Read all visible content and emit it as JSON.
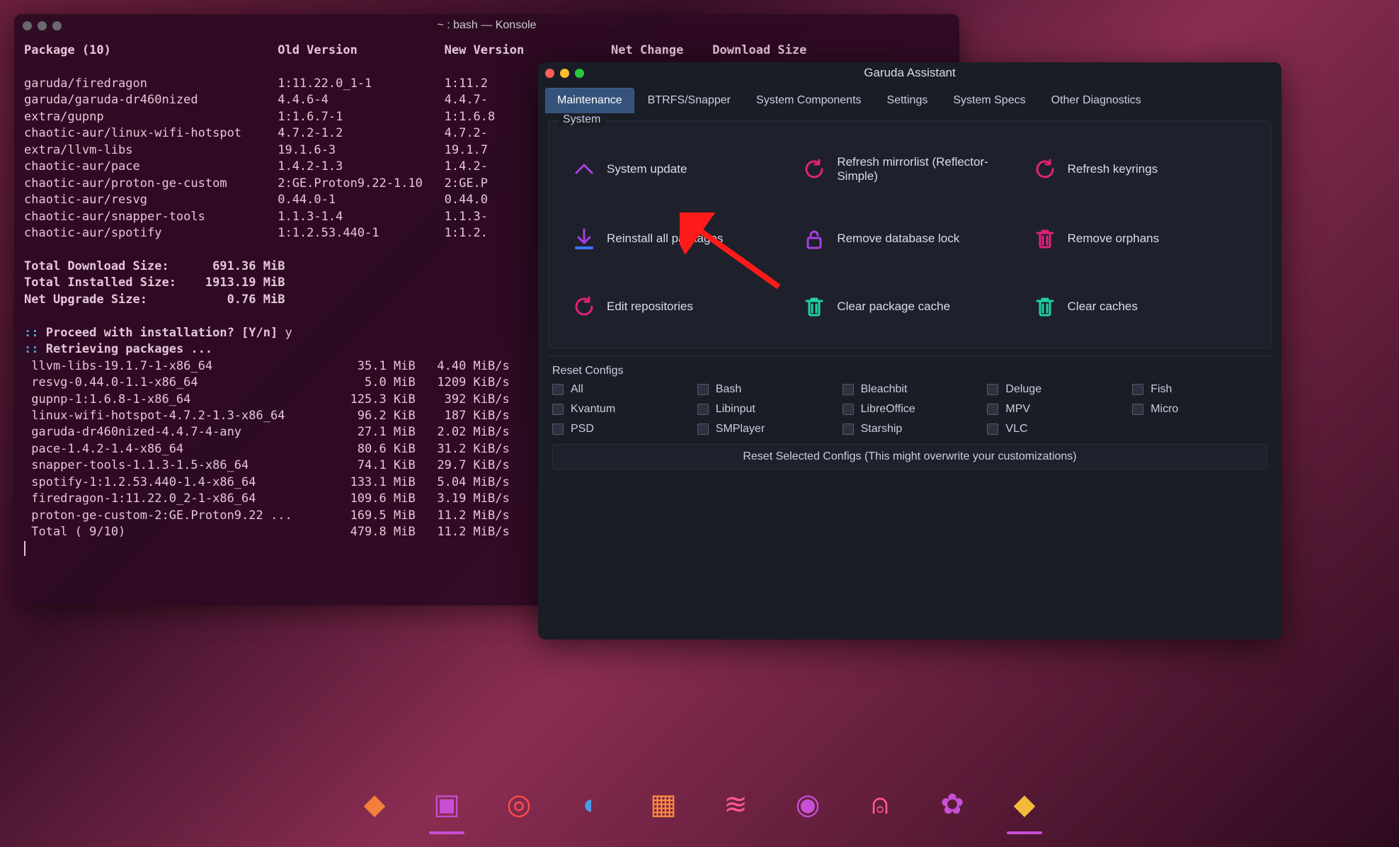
{
  "konsole": {
    "title": "~ : bash — Konsole",
    "header": {
      "col1": "Package (10)",
      "col2": "Old Version",
      "col3": "New Version",
      "col4": "Net Change",
      "col5": "Download Size"
    },
    "packages": [
      {
        "name": "garuda/firedragon",
        "old": "1:11.22.0_1-1",
        "new_prefix": "1:11.2"
      },
      {
        "name": "garuda/garuda-dr460nized",
        "old": "4.4.6-4",
        "new_prefix": "4.4.7-"
      },
      {
        "name": "extra/gupnp",
        "old": "1:1.6.7-1",
        "new_prefix": "1:1.6.8"
      },
      {
        "name": "chaotic-aur/linux-wifi-hotspot",
        "old": "4.7.2-1.2",
        "new_prefix": "4.7.2-"
      },
      {
        "name": "extra/llvm-libs",
        "old": "19.1.6-3",
        "new_prefix": "19.1.7"
      },
      {
        "name": "chaotic-aur/pace",
        "old": "1.4.2-1.3",
        "new_prefix": "1.4.2-"
      },
      {
        "name": "chaotic-aur/proton-ge-custom",
        "old": "2:GE.Proton9.22-1.10",
        "new_prefix": "2:GE.P"
      },
      {
        "name": "chaotic-aur/resvg",
        "old": "0.44.0-1",
        "new_prefix": "0.44.0"
      },
      {
        "name": "chaotic-aur/snapper-tools",
        "old": "1.1.3-1.4",
        "new_prefix": "1.1.3-"
      },
      {
        "name": "chaotic-aur/spotify",
        "old": "1:1.2.53.440-1",
        "new_prefix": "1:1.2."
      }
    ],
    "totals": [
      {
        "label": "Total Download Size:",
        "value": " 691.36 MiB"
      },
      {
        "label": "Total Installed Size:",
        "value": "1913.19 MiB"
      },
      {
        "label": "Net Upgrade Size:",
        "value": "   0.76 MiB"
      }
    ],
    "prompt": ":: Proceed with installation? [Y/n] ",
    "prompt_answer": "y",
    "retr": ":: Retrieving packages ...",
    "downloads": [
      {
        "pkg": "llvm-libs-19.1.7-1-x86_64",
        "size": "35.1 MiB",
        "speed": "4.40 MiB/s"
      },
      {
        "pkg": "resvg-0.44.0-1.1-x86_64",
        "size": "5.0 MiB",
        "speed": "1209 KiB/s"
      },
      {
        "pkg": "gupnp-1:1.6.8-1-x86_64",
        "size": "125.3 KiB",
        "speed": " 392 KiB/s"
      },
      {
        "pkg": "linux-wifi-hotspot-4.7.2-1.3-x86_64",
        "size": "96.2 KiB",
        "speed": " 187 KiB/s"
      },
      {
        "pkg": "garuda-dr460nized-4.4.7-4-any",
        "size": "27.1 MiB",
        "speed": "2.02 MiB/s"
      },
      {
        "pkg": "pace-1.4.2-1.4-x86_64",
        "size": "80.6 KiB",
        "speed": "31.2 KiB/s"
      },
      {
        "pkg": "snapper-tools-1.1.3-1.5-x86_64",
        "size": "74.1 KiB",
        "speed": "29.7 KiB/s"
      },
      {
        "pkg": "spotify-1:1.2.53.440-1.4-x86_64",
        "size": "133.1 MiB",
        "speed": "5.04 MiB/s"
      },
      {
        "pkg": "firedragon-1:11.22.0_2-1-x86_64",
        "size": "109.6 MiB",
        "speed": "3.19 MiB/s"
      },
      {
        "pkg": "proton-ge-custom-2:GE.Proton9.22 ...",
        "size": "169.5 MiB",
        "speed": "11.2 MiB/s"
      },
      {
        "pkg": "Total ( 9/10)",
        "size": "479.8 MiB",
        "speed": "11.2 MiB/s"
      }
    ]
  },
  "assistant": {
    "title": "Garuda Assistant",
    "tabs": [
      "Maintenance",
      "BTRFS/Snapper",
      "System Components",
      "Settings",
      "System Specs",
      "Other Diagnostics"
    ],
    "active_tab": 0,
    "system_label": "System",
    "items": [
      {
        "label": "System update",
        "icon": "chevron-up",
        "color": "#a83fe0"
      },
      {
        "label": "Refresh mirrorlist (Reflector-Simple)",
        "icon": "refresh-circle",
        "color": "#e0217a"
      },
      {
        "label": "Refresh keyrings",
        "icon": "refresh-circle",
        "color": "#e0217a"
      },
      {
        "label": "Reinstall all packages",
        "icon": "download",
        "color": "#a83fe0"
      },
      {
        "label": "Remove database lock",
        "icon": "unlock",
        "color": "#a83fe0"
      },
      {
        "label": "Remove orphans",
        "icon": "trash",
        "color": "#e0217a"
      },
      {
        "label": "Edit repositories",
        "icon": "refresh-circle",
        "color": "#e0217a"
      },
      {
        "label": "Clear package cache",
        "icon": "trash",
        "color": "#1fd1a8"
      },
      {
        "label": "Clear caches",
        "icon": "trash",
        "color": "#1fd1a8"
      }
    ],
    "reset_label": "Reset Configs",
    "reset_items": [
      "All",
      "Bash",
      "Bleachbit",
      "Deluge",
      "Fish",
      "Kvantum",
      "Libinput",
      "LibreOffice",
      "MPV",
      "Micro",
      "PSD",
      "SMPlayer",
      "Starship",
      "VLC"
    ],
    "reset_button": "Reset Selected Configs (This might overwrite your customizations)"
  },
  "dock_items": [
    {
      "name": "garuda-home-icon"
    },
    {
      "name": "terminal-icon",
      "active": true
    },
    {
      "name": "vivaldi-icon"
    },
    {
      "name": "cloud-app-icon"
    },
    {
      "name": "file-manager-icon"
    },
    {
      "name": "pulse-icon"
    },
    {
      "name": "swirl-icon"
    },
    {
      "name": "ghost-icon"
    },
    {
      "name": "gear-icon"
    },
    {
      "name": "assistant-icon",
      "active": true
    }
  ]
}
